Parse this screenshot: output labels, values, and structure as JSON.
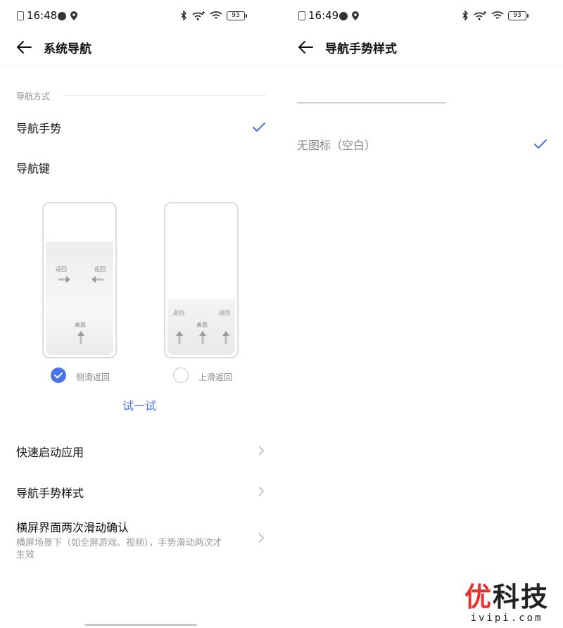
{
  "left": {
    "status": {
      "time": "16:48",
      "battery": "93"
    },
    "header": {
      "title": "系统导航"
    },
    "section_label": "导航方式",
    "options": [
      {
        "label": "导航手势",
        "selected": true
      },
      {
        "label": "导航键",
        "selected": false
      }
    ],
    "gesture_styles": {
      "side": {
        "label": "侧滑返回",
        "selected": true,
        "back_label": "返回",
        "home_label": "桌面"
      },
      "up": {
        "label": "上滑返回",
        "selected": false,
        "back_label": "返回",
        "home_label": "桌面"
      }
    },
    "try_label": "试一试",
    "list": [
      {
        "title": "快速启动应用",
        "desc": ""
      },
      {
        "title": "导航手势样式",
        "desc": ""
      },
      {
        "title": "横屏界面两次滑动确认",
        "desc": "横屏场景下（如全屏游戏、视频），手势滑动两次才生效"
      }
    ],
    "accent_color": "#4a73e8"
  },
  "right": {
    "status": {
      "time": "16:49",
      "battery": "93"
    },
    "header": {
      "title": "导航手势样式"
    },
    "options": [
      {
        "label": "无图标（空白）",
        "selected": true
      }
    ]
  },
  "watermark": {
    "main": "优科技",
    "first_char": "优",
    "rest_chars": "科技",
    "sub": "ivipi.com"
  }
}
